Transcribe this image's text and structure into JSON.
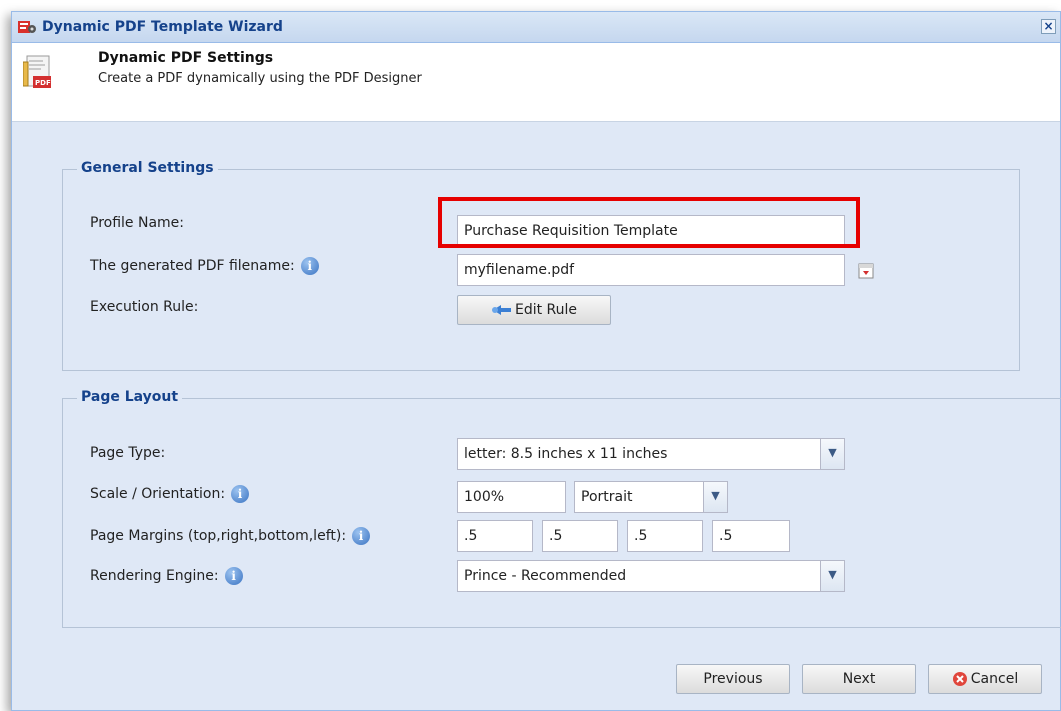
{
  "window": {
    "title": "Dynamic PDF Template Wizard"
  },
  "header": {
    "title": "Dynamic PDF Settings",
    "subtitle": "Create a PDF dynamically using the PDF Designer"
  },
  "general": {
    "legend": "General Settings",
    "profile_name_label": "Profile Name:",
    "profile_name_value": "Purchase Requisition Template",
    "filename_label": "The generated PDF filename:",
    "filename_value": "myfilename.pdf",
    "execution_rule_label": "Execution Rule:",
    "edit_rule_label": "Edit Rule"
  },
  "layout": {
    "legend": "Page Layout",
    "page_type_label": "Page Type:",
    "page_type_value": "letter: 8.5 inches x 11 inches",
    "scale_label": "Scale / Orientation:",
    "scale_value": "100%",
    "orientation_value": "Portrait",
    "margins_label": "Page Margins (top,right,bottom,left):",
    "margin_top": ".5",
    "margin_right": ".5",
    "margin_bottom": ".5",
    "margin_left": ".5",
    "engine_label": "Rendering Engine:",
    "engine_value": "Prince - Recommended"
  },
  "footer": {
    "previous_label": "Previous",
    "next_label": "Next",
    "cancel_label": "Cancel"
  },
  "icons": {
    "info": "i",
    "close": "×",
    "dropdown": "▼"
  },
  "colors": {
    "title_text": "#15428b",
    "highlight": "#e60000",
    "panel_bg": "#dfe8f6"
  }
}
